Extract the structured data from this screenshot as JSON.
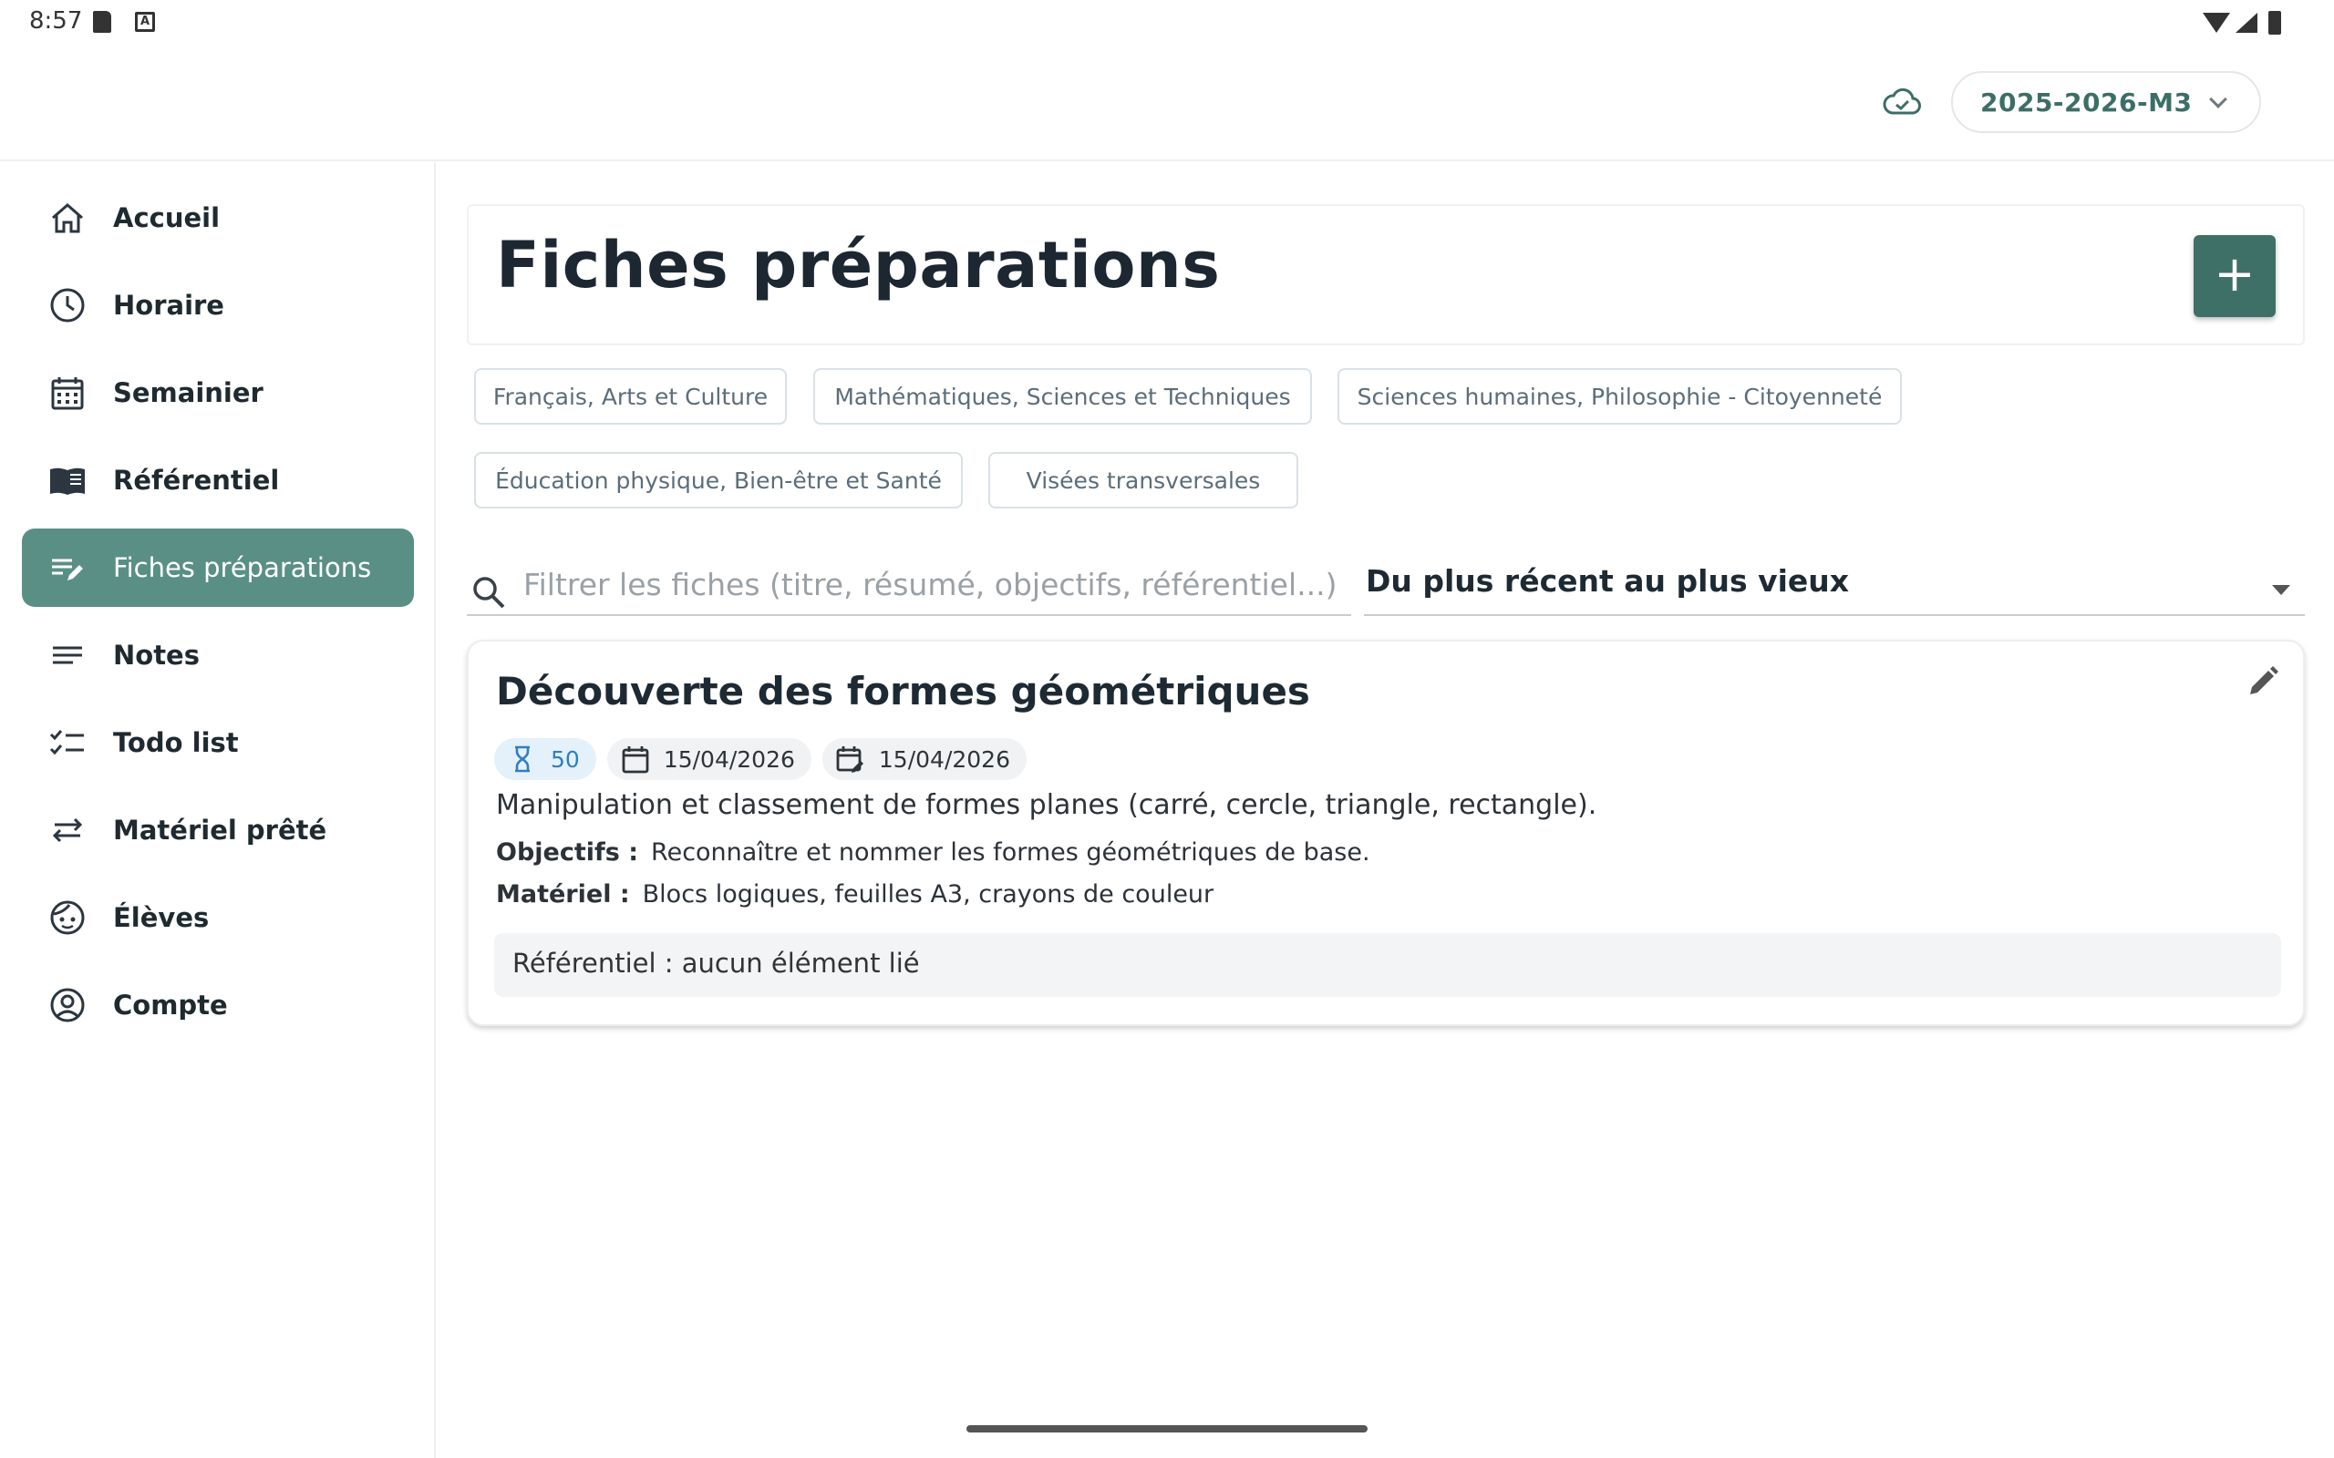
{
  "status_bar": {
    "time": "8:57"
  },
  "top_bar": {
    "year_selector": "2025-2026-M3"
  },
  "sidebar": {
    "items": [
      {
        "label": "Accueil",
        "icon": "home-icon"
      },
      {
        "label": "Horaire",
        "icon": "clock-icon"
      },
      {
        "label": "Semainier",
        "icon": "calendar-icon"
      },
      {
        "label": "Référentiel",
        "icon": "book-icon"
      },
      {
        "label": "Fiches préparations",
        "icon": "edit-note-icon",
        "active": true
      },
      {
        "label": "Notes",
        "icon": "notes-icon"
      },
      {
        "label": "Todo list",
        "icon": "checklist-icon"
      },
      {
        "label": "Matériel prêté",
        "icon": "swap-icon"
      },
      {
        "label": "Élèves",
        "icon": "face-icon"
      },
      {
        "label": "Compte",
        "icon": "account-icon"
      }
    ]
  },
  "main": {
    "title": "Fiches préparations",
    "add_label": "+",
    "filters": [
      "Français, Arts et Culture",
      "Mathématiques, Sciences et Techniques",
      "Sciences humaines, Philosophie - Citoyenneté",
      "Éducation physique, Bien-être et Santé",
      "Visées transversales"
    ],
    "search": {
      "placeholder": "Filtrer les fiches (titre, résumé, objectifs, référentiel...)"
    },
    "sort": {
      "selected": "Du plus récent au plus vieux"
    },
    "fiches": [
      {
        "title": "Découverte des formes géométriques",
        "duration": "50",
        "date_created": "15/04/2026",
        "date_edited": "15/04/2026",
        "summary": "Manipulation et classement de formes planes (carré, cercle, triangle, rectangle).",
        "objectifs_label": "Objectifs :",
        "objectifs": "Reconnaître et nommer les formes géométriques de base.",
        "materiel_label": "Matériel :",
        "materiel": "Blocs logiques, feuilles A3, crayons de couleur",
        "referentiel": "Référentiel : aucun élément lié"
      }
    ]
  },
  "colors": {
    "accent": "#5a8f86",
    "accent_dark": "#3e7068",
    "year_text": "#3c6e66",
    "duration_blue": "#2f7fc0"
  }
}
